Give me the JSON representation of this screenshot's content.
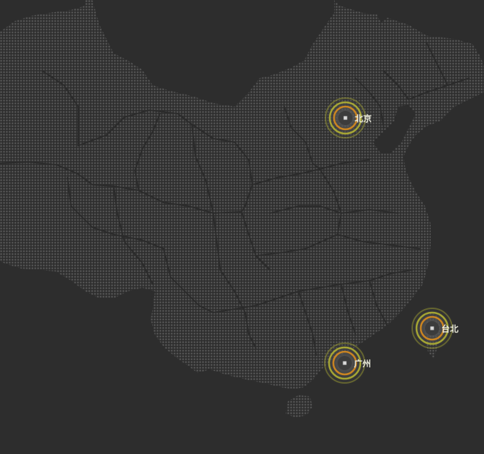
{
  "map": {
    "background_color": "#2d2d2d",
    "land_dot_color": "#5a5a5a",
    "border_color": "#2f2f2f",
    "ring_color_outer": "#c8c832",
    "ring_color_inner": "#d98c1e",
    "cities": [
      {
        "id": "beijing",
        "label": "北京"
      },
      {
        "id": "taipei",
        "label": "台北"
      },
      {
        "id": "guangzhou",
        "label": "广州"
      }
    ]
  }
}
